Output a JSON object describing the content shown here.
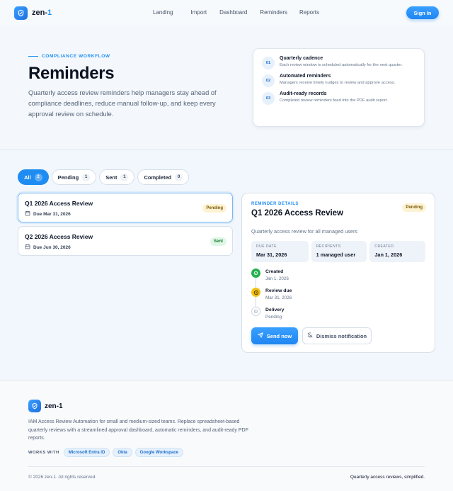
{
  "brand": {
    "name": "zen-",
    "name_accent": "1"
  },
  "nav": {
    "links": [
      "Landing",
      "Import",
      "Dashboard",
      "Reminders",
      "Reports"
    ],
    "signin_label": "Sign In"
  },
  "hero": {
    "eyebrow": "COMPLIANCE WORKFLOW",
    "title": "Reminders",
    "description": "Quarterly access review reminders help managers stay ahead of compliance deadlines, reduce manual follow-up, and keep every approval review on schedule.",
    "steps": [
      {
        "num": "01",
        "title": "Quarterly cadence",
        "desc": "Each review window is scheduled automatically for the next quarter."
      },
      {
        "num": "02",
        "title": "Automated reminders",
        "desc": "Managers receive timely nudges to review and approve access."
      },
      {
        "num": "03",
        "title": "Audit-ready records",
        "desc": "Completed review reminders feed into the PDF audit report."
      }
    ]
  },
  "filters": [
    {
      "label": "All",
      "count": "2",
      "active": true
    },
    {
      "label": "Pending",
      "count": "1",
      "active": false
    },
    {
      "label": "Sent",
      "count": "1",
      "active": false
    },
    {
      "label": "Completed",
      "count": "0",
      "active": false
    }
  ],
  "reminders": [
    {
      "title": "Q1 2026 Access Review",
      "due": "Due Mar 31, 2026",
      "status": "Pending",
      "selected": true
    },
    {
      "title": "Q2 2026 Access Review",
      "due": "Due Jun 30, 2026",
      "status": "Sent",
      "selected": false
    }
  ],
  "detail": {
    "eyebrow": "REMINDER DETAILS",
    "title": "Q1 2026 Access Review",
    "status": "Pending",
    "subtitle": "Quarterly access review for all managed users",
    "meta": [
      {
        "key": "DUE DATE",
        "value": "Mar 31, 2026"
      },
      {
        "key": "RECIPIENTS",
        "value": "1 managed user"
      },
      {
        "key": "CREATED",
        "value": "Jan 1, 2026"
      }
    ],
    "timeline": [
      {
        "title": "Created",
        "sub": "Jan 1, 2026",
        "state": "done"
      },
      {
        "title": "Review due",
        "sub": "Mar 31, 2026",
        "state": "due"
      },
      {
        "title": "Delivery",
        "sub": "Pending",
        "state": "wait"
      }
    ],
    "send_label": "Send now",
    "dismiss_label": "Dismiss notification"
  },
  "footer": {
    "brand": "zen-1",
    "description": "IAM Access Review Automation for small and medium-sized teams. Replace spreadsheet-based quarterly reviews with a streamlined approval dashboard, automatic reminders, and audit-ready PDF reports.",
    "works_with_label": "WORKS WITH",
    "integrations": [
      "Microsoft Entra ID",
      "Okta",
      "Google Workspace"
    ],
    "copyright": "© 2026 zen-1. All rights reserved.",
    "tagline": "Quarterly access reviews, simplified."
  },
  "colors": {
    "accent": "#1e8ef5",
    "pending_bg": "#fdf3d3",
    "sent_bg": "#e1f7e6",
    "done": "#22b14c",
    "due": "#f3c211"
  }
}
